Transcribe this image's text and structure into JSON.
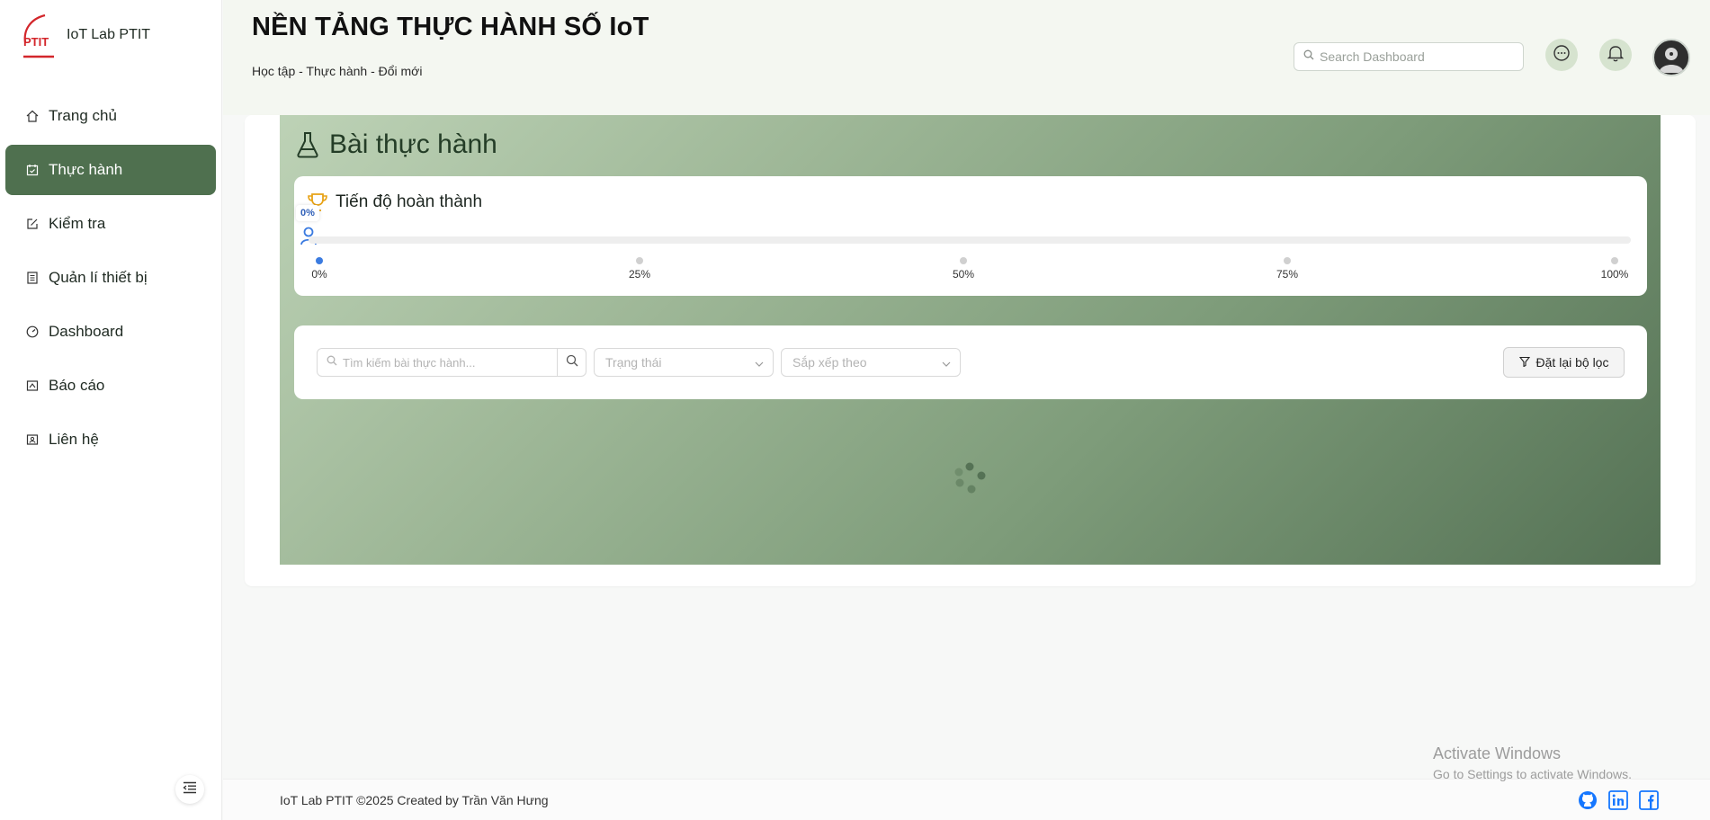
{
  "app": {
    "brand_name": "IoT Lab PTIT",
    "logo_text": "PTIT"
  },
  "sidebar": {
    "items": [
      {
        "label": "Trang chủ",
        "icon": "home-icon"
      },
      {
        "label": "Thực hành",
        "icon": "calendar-check-icon",
        "active": true
      },
      {
        "label": "Kiểm tra",
        "icon": "edit-icon"
      },
      {
        "label": "Quản lí thiết bị",
        "icon": "list-icon"
      },
      {
        "label": "Dashboard",
        "icon": "dashboard-icon"
      },
      {
        "label": "Báo cáo",
        "icon": "report-icon"
      },
      {
        "label": "Liên hệ",
        "icon": "contact-icon"
      }
    ]
  },
  "header": {
    "title": "NỀN TẢNG THỰC HÀNH SỐ IoT",
    "subtitle": "Học tập - Thực hành - Đổi mới",
    "search_placeholder": "Search Dashboard"
  },
  "main": {
    "heading": "Bài thực hành",
    "progress": {
      "title": "Tiến độ hoàn thành",
      "value_percent": 0,
      "badge": "0%",
      "ticks": [
        "0%",
        "25%",
        "50%",
        "75%",
        "100%"
      ]
    },
    "filters": {
      "search_placeholder": "Tìm kiếm bài thực hành...",
      "status_placeholder": "Trạng thái",
      "sort_placeholder": "Sắp xếp theo",
      "reset_label": "Đặt lại bộ lọc"
    }
  },
  "footer": {
    "copyright": "IoT Lab PTIT ©2025 Created by Trần Văn Hưng"
  },
  "overlay": {
    "activate_title": "Activate Windows",
    "activate_sub": "Go to Settings to activate Windows."
  },
  "colors": {
    "accent": "#4f704f",
    "progress": "#3b7be0",
    "header_bg": "#f4f7f1"
  }
}
